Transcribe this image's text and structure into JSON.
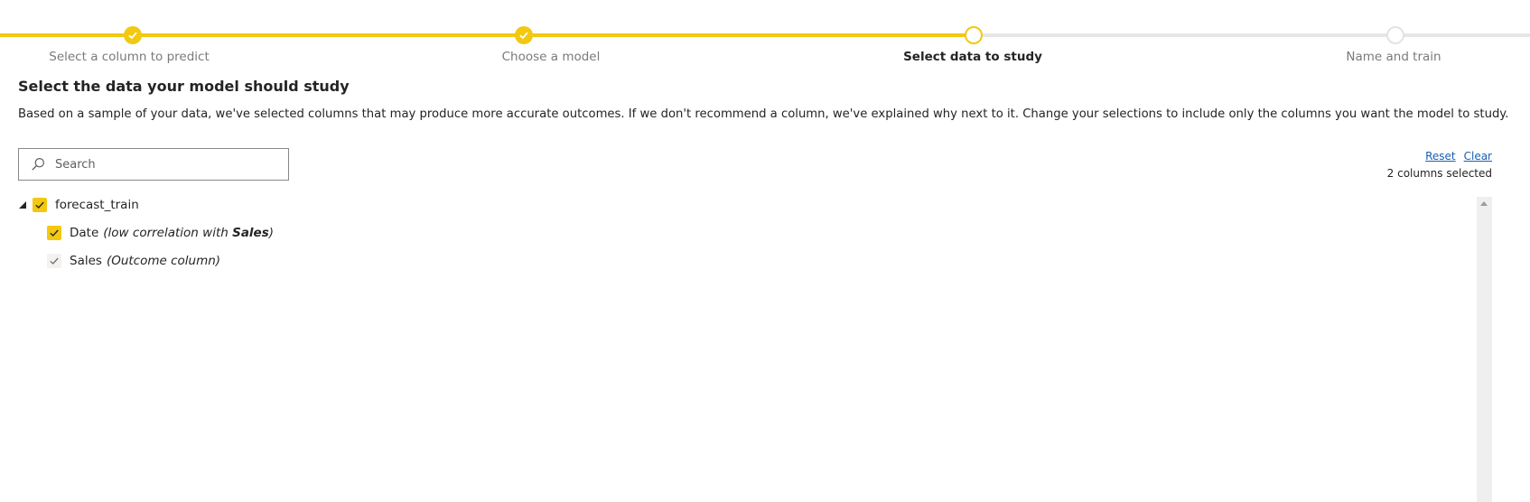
{
  "colors": {
    "accent": "#f2c811",
    "track_todo": "#e6e6e6",
    "link": "#1a5fb4"
  },
  "stepper": {
    "steps": [
      {
        "label": "Select a column to predict",
        "state": "done"
      },
      {
        "label": "Choose a model",
        "state": "done"
      },
      {
        "label": "Select data to study",
        "state": "current"
      },
      {
        "label": "Name and train",
        "state": "todo"
      }
    ]
  },
  "page": {
    "title": "Select the data your model should study",
    "description": "Based on a sample of your data, we've selected columns that may produce more accurate outcomes. If we don't recommend a column, we've explained why next to it. Change your selections to include only the columns you want the model to study."
  },
  "search": {
    "placeholder": "Search",
    "value": ""
  },
  "actions": {
    "reset_label": "Reset",
    "clear_label": "Clear",
    "selection_count": "2 columns selected"
  },
  "tree": {
    "table": {
      "name": "forecast_train",
      "checked": true,
      "expanded": true
    },
    "columns": [
      {
        "name": "Date",
        "note_prefix": "(low correlation with ",
        "note_bold": "Sales",
        "note_suffix": ")",
        "checked": true,
        "locked": false
      },
      {
        "name": "Sales",
        "note": "(Outcome column)",
        "checked": true,
        "locked": true
      }
    ]
  }
}
